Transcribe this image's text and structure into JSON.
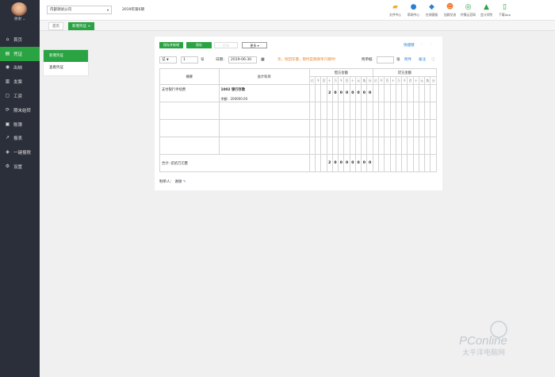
{
  "user": {
    "name": "谢谢"
  },
  "nav": [
    {
      "label": "首页",
      "icon": "home-icon"
    },
    {
      "label": "凭证",
      "icon": "voucher-icon"
    },
    {
      "label": "出纳",
      "icon": "cashier-icon"
    },
    {
      "label": "发票",
      "icon": "invoice-icon"
    },
    {
      "label": "工资",
      "icon": "salary-icon"
    },
    {
      "label": "期末结转",
      "icon": "period-end-icon"
    },
    {
      "label": "账簿",
      "icon": "ledger-icon"
    },
    {
      "label": "报表",
      "icon": "report-icon"
    },
    {
      "label": "一键报税",
      "icon": "tax-icon"
    },
    {
      "label": "设置",
      "icon": "settings-icon"
    }
  ],
  "nav_active": "凭证",
  "company": "内部测试公司",
  "period": "2019年第6期",
  "tools": [
    {
      "label": "文件中心",
      "icon": "folder-icon",
      "color": "#f0a830"
    },
    {
      "label": "帮助中心",
      "icon": "help-icon",
      "color": "#2a7fd4"
    },
    {
      "label": "在线客服",
      "icon": "service-icon",
      "color": "#2a7fd4"
    },
    {
      "label": "加群交流",
      "icon": "group-icon",
      "color": "#f07830"
    },
    {
      "label": "柠檬云官网",
      "icon": "website-icon",
      "color": "#2aa343"
    },
    {
      "label": "会计学院",
      "icon": "academy-icon",
      "color": "#2aa343"
    },
    {
      "label": "下载App",
      "icon": "phone-icon",
      "color": "#2aa343"
    }
  ],
  "tabs": {
    "home": "首页",
    "active": "新增凭证",
    "close": "×"
  },
  "subnav": {
    "new": "新增凭证",
    "view": "查看凭证"
  },
  "toolbar": {
    "save_new": "保存并新增",
    "save": "保存",
    "print": "打印",
    "more": "更多",
    "shortcut": "快捷键"
  },
  "voucher": {
    "type": "记",
    "number": "1",
    "number_unit": "号",
    "date_label": "日期：",
    "date": "2019-06-30",
    "warning": "亲，找回车键，暂时是跳保单只跳时!",
    "attach_label": "附单据",
    "attach_unit": "张",
    "attach_link": "附件",
    "note_link": "备注"
  },
  "table": {
    "col_summary": "摘要",
    "col_account": "会计科目",
    "col_debit": "借方金额",
    "col_credit": "贷方金额",
    "digit_units": [
      "亿",
      "千",
      "百",
      "十",
      "万",
      "千",
      "百",
      "十",
      "元",
      "角",
      "分"
    ],
    "rows": [
      {
        "summary": "支付银行手续费",
        "account": "1002 银行存款",
        "balance": "余额：200000.00",
        "debit_digits": [
          "",
          "",
          "",
          "2",
          "0",
          "0",
          "0",
          "0",
          "0",
          "0",
          "0"
        ],
        "credit_digits": [
          "",
          "",
          "",
          "",
          "",
          "",
          "",
          "",
          "",
          "",
          ""
        ]
      },
      {
        "summary": "",
        "account": "",
        "balance": "",
        "debit_digits": [
          "",
          "",
          "",
          "",
          "",
          "",
          "",
          "",
          "",
          "",
          ""
        ],
        "credit_digits": [
          "",
          "",
          "",
          "",
          "",
          "",
          "",
          "",
          "",
          "",
          ""
        ]
      },
      {
        "summary": "",
        "account": "",
        "balance": "",
        "debit_digits": [
          "",
          "",
          "",
          "",
          "",
          "",
          "",
          "",
          "",
          "",
          ""
        ],
        "credit_digits": [
          "",
          "",
          "",
          "",
          "",
          "",
          "",
          "",
          "",
          "",
          ""
        ]
      },
      {
        "summary": "",
        "account": "",
        "balance": "",
        "debit_digits": [
          "",
          "",
          "",
          "",
          "",
          "",
          "",
          "",
          "",
          "",
          ""
        ],
        "credit_digits": [
          "",
          "",
          "",
          "",
          "",
          "",
          "",
          "",
          "",
          "",
          ""
        ]
      }
    ],
    "total_label": "合计: 贰拾万元整",
    "total_debit_digits": [
      "",
      "",
      "",
      "2",
      "0",
      "0",
      "0",
      "0",
      "0",
      "0",
      "0"
    ],
    "total_credit_digits": [
      "",
      "",
      "",
      "",
      "",
      "",
      "",
      "",
      "",
      "",
      ""
    ]
  },
  "maker": {
    "label": "制单人：",
    "name": "谢谢"
  },
  "watermark": {
    "brand": "PConline",
    "sub": "太平洋电脑网"
  }
}
